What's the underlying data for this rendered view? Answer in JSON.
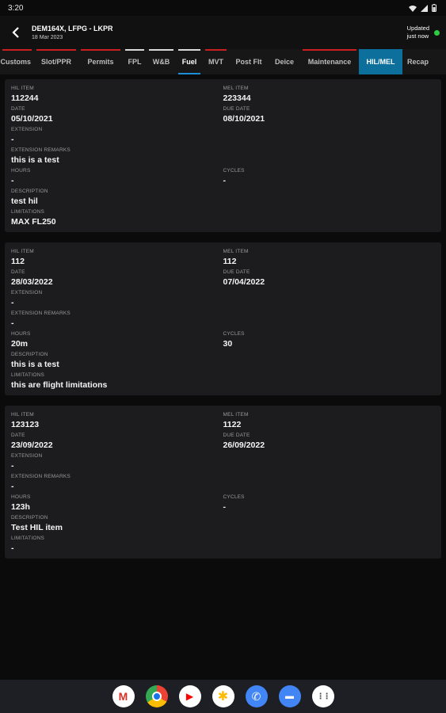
{
  "status_bar": {
    "time": "3:20"
  },
  "header": {
    "title": "DEM164X, LFPG - LKPR",
    "date": "18 Mar 2023",
    "update_line1": "Updated",
    "update_line2": "just now"
  },
  "tabs": [
    {
      "label": "Customs",
      "top_color": "#cc1f1f"
    },
    {
      "label": "Slot/PPR",
      "top_color": "#cc1f1f"
    },
    {
      "label": "Permits",
      "top_color": "#cc1f1f"
    },
    {
      "label": "FPL",
      "top_color": "#d9d9d9"
    },
    {
      "label": "W&B",
      "top_color": "#d9d9d9"
    },
    {
      "label": "Fuel",
      "top_color": "#d9d9d9"
    },
    {
      "label": "MVT",
      "top_color": "#cc1f1f"
    },
    {
      "label": "Post Flt",
      "top_color": "#171717"
    },
    {
      "label": "Deice",
      "top_color": "#171717"
    },
    {
      "label": "Maintenance",
      "top_color": "#cc1f1f"
    },
    {
      "label": "HIL/MEL",
      "top_color": "#0d6f9c"
    },
    {
      "label": "Recap",
      "top_color": "#171717"
    }
  ],
  "labels": {
    "hil_item": "HIL ITEM",
    "mel_item": "MEL ITEM",
    "date": "DATE",
    "due_date": "DUE DATE",
    "extension": "EXTENSION",
    "extension_remarks": "EXTENSION REMARKS",
    "hours": "HOURS",
    "cycles": "CYCLES",
    "description": "DESCRIPTION",
    "limitations": "LIMITATIONS"
  },
  "items": [
    {
      "hil_item": "112244",
      "mel_item": "223344",
      "date": "05/10/2021",
      "due_date": "08/10/2021",
      "extension": "-",
      "extension_remarks": "this is a test",
      "hours": "-",
      "cycles": "-",
      "description": "test hil",
      "limitations": "MAX FL250"
    },
    {
      "hil_item": "112",
      "mel_item": "112",
      "date": "28/03/2022",
      "due_date": "07/04/2022",
      "extension": "-",
      "extension_remarks": "-",
      "hours": "20m",
      "cycles": "30",
      "description": "this is a test",
      "limitations": "this are flight limitations"
    },
    {
      "hil_item": "123123",
      "mel_item": "1122",
      "date": "23/09/2022",
      "due_date": "26/09/2022",
      "extension": "-",
      "extension_remarks": "-",
      "hours": "123h",
      "cycles": "-",
      "description": "Test HIL item",
      "limitations": "-"
    }
  ],
  "nav_apps": [
    {
      "name": "gmail-icon",
      "glyph": "M",
      "bg": "#ffffff",
      "fg": "#d93025"
    },
    {
      "name": "chrome-icon",
      "glyph": "●",
      "bg": "#ffffff",
      "fg": "#1a73e8"
    },
    {
      "name": "youtube-icon",
      "glyph": "▶",
      "bg": "#ffffff",
      "fg": "#ff0000"
    },
    {
      "name": "photos-icon",
      "glyph": "✱",
      "bg": "#ffffff",
      "fg": "#fbbc04"
    },
    {
      "name": "phone-icon",
      "glyph": "✆",
      "bg": "#4285f4",
      "fg": "#ffffff"
    },
    {
      "name": "messages-icon",
      "glyph": "▬",
      "bg": "#4285f4",
      "fg": "#ffffff"
    },
    {
      "name": "app-drawer-icon",
      "glyph": "⋮⋮",
      "bg": "#ffffff",
      "fg": "#3c4043"
    }
  ],
  "colors": {
    "accent": "#0d6f9c",
    "alert": "#cc1f1f",
    "online": "#2ecc40"
  }
}
